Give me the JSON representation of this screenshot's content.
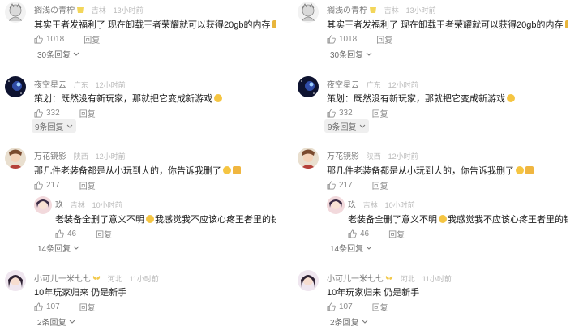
{
  "comments": [
    {
      "name": "搁浅の青柠",
      "location": "吉林",
      "time": "13小时前",
      "text": "其实王者发福利了 现在卸载王者荣耀就可以获得20gb的内存",
      "likes": "1018",
      "reply_label": "回复",
      "more_label": "30条回复"
    },
    {
      "name": "夜空星云",
      "location": "广东",
      "time": "12小时前",
      "text": "策划：既然没有新玩家，那就把它变成新游戏",
      "likes": "332",
      "reply_label": "回复",
      "more_label": "9条回复"
    },
    {
      "name": "万花镜影",
      "location": "陕西",
      "time": "12小时前",
      "text": "那几件老装备都是从小玩到大的，你告诉我删了",
      "likes": "217",
      "reply_label": "回复",
      "more_label": "14条回复",
      "sub_reply": {
        "name": "玖",
        "location": "吉林",
        "time": "10小时前",
        "text_a": "老装备全删了意义不明",
        "text_b": "我感觉我不应该心疼王者里的钱就留着王者了",
        "likes": "46",
        "reply_label": "回复"
      }
    },
    {
      "name": "小可儿一米七七",
      "location": "河北",
      "time": "11小时前",
      "text": "10年玩家归来 仍是新手",
      "likes": "107",
      "reply_label": "回复",
      "more_label": "2条回复"
    }
  ],
  "colors": {
    "meta_name": "#7a7a7a",
    "meta_sub": "#b9b9b9",
    "text": "#1c1c1c",
    "action": "#8a8a8a"
  }
}
